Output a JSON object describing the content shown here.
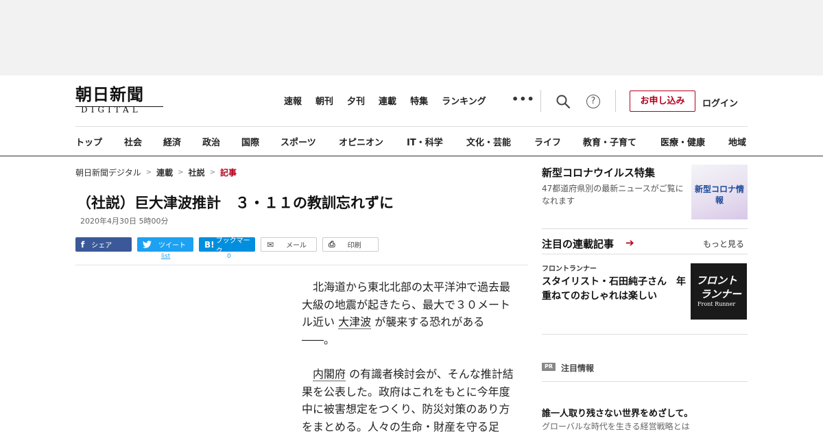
{
  "header": {
    "logo_kanji": "朝日新聞",
    "logo_sub": "DIGITAL",
    "topnav": [
      "速報",
      "朝刊",
      "夕刊",
      "連載",
      "特集",
      "ランキング"
    ],
    "more": "•••",
    "help": "?",
    "apply_label": "お申し込み",
    "login_label": "ログイン"
  },
  "categories": [
    "トップ",
    "社会",
    "経済",
    "政治",
    "国際",
    "スポーツ",
    "オピニオン",
    "IT・科学",
    "文化・芸能",
    "ライフ",
    "教育・子育て",
    "医療・健康",
    "地域"
  ],
  "breadcrumb": {
    "items": [
      "朝日新聞デジタル",
      "連載",
      "社説"
    ],
    "current": "記事",
    "sep": ">"
  },
  "article": {
    "headline": "（社説）巨大津波推計　３・１１の教訓忘れずに",
    "date": "2020年4月30日 5時00分",
    "p1_a": "北海道から東北北部の太平洋沖で過去最大級の地震が起きたら、最大で３０メートル近い",
    "p1_kw": "大津波",
    "p1_b": "が襲来する恐れがある――。",
    "p2_kw": "内閣府",
    "p2_b": "の有識者検討会が、そんな推計結果を公表した。政府はこれをもとに今年度中に被害想定をつくり、防災対策のあり方をまとめる。人々の生命・財産を守る足"
  },
  "share": {
    "facebook": "シェア",
    "twitter": "ツイート",
    "hatena": "ブックマーク",
    "mail": "メール",
    "print": "印刷",
    "twitter_count": "list",
    "hatena_count": "0",
    "facebook_icon": "f",
    "hatena_icon": "B!",
    "mail_icon": "✉",
    "print_icon": "⎙"
  },
  "sidebar": {
    "corona_title": "新型コロナウイルス特集",
    "corona_desc": "47都道府県別の最新ニュースがご覧になれます",
    "corona_thumb_label": "新型コロナ情報",
    "renai_title": "注目の連載記事",
    "renai_arrow": "➔",
    "see_more": "もっと見る",
    "front_label": "フロントランナー",
    "front_headline": "スタイリスト・石田純子さん　年重ねてのおしゃれは楽しい",
    "front_thumb_1": "フロント",
    "front_thumb_2": "ランナー",
    "front_thumb_3": "Front Runner",
    "pr_badge": "PR",
    "pr_label": "注目情報",
    "pr_headline": "誰一人取り残さない世界をめざして。",
    "pr_sub": "グローバルな時代を生きる経営戦略とは"
  }
}
